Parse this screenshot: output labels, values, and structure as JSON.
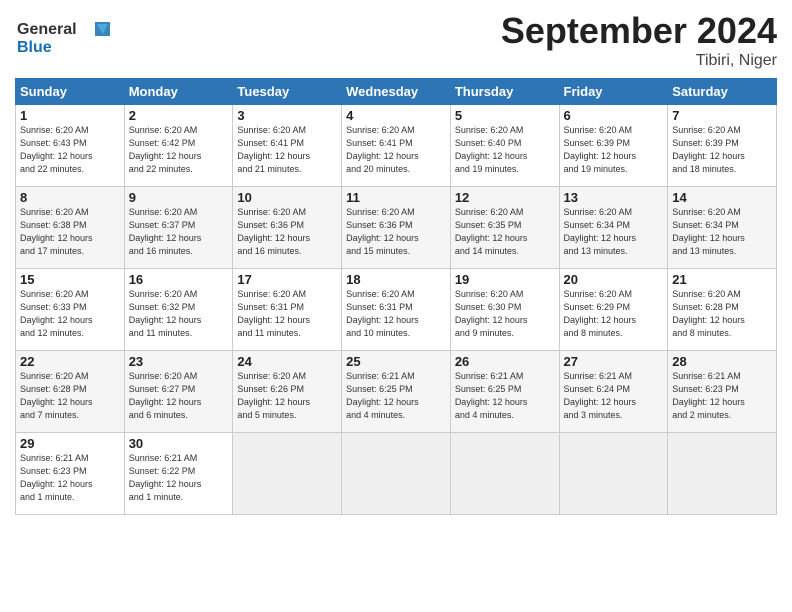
{
  "header": {
    "logo_line1": "General",
    "logo_line2": "Blue",
    "month": "September 2024",
    "location": "Tibiri, Niger"
  },
  "days_of_week": [
    "Sunday",
    "Monday",
    "Tuesday",
    "Wednesday",
    "Thursday",
    "Friday",
    "Saturday"
  ],
  "weeks": [
    [
      {
        "day": "1",
        "info": "Sunrise: 6:20 AM\nSunset: 6:43 PM\nDaylight: 12 hours\nand 22 minutes."
      },
      {
        "day": "2",
        "info": "Sunrise: 6:20 AM\nSunset: 6:42 PM\nDaylight: 12 hours\nand 22 minutes."
      },
      {
        "day": "3",
        "info": "Sunrise: 6:20 AM\nSunset: 6:41 PM\nDaylight: 12 hours\nand 21 minutes."
      },
      {
        "day": "4",
        "info": "Sunrise: 6:20 AM\nSunset: 6:41 PM\nDaylight: 12 hours\nand 20 minutes."
      },
      {
        "day": "5",
        "info": "Sunrise: 6:20 AM\nSunset: 6:40 PM\nDaylight: 12 hours\nand 19 minutes."
      },
      {
        "day": "6",
        "info": "Sunrise: 6:20 AM\nSunset: 6:39 PM\nDaylight: 12 hours\nand 19 minutes."
      },
      {
        "day": "7",
        "info": "Sunrise: 6:20 AM\nSunset: 6:39 PM\nDaylight: 12 hours\nand 18 minutes."
      }
    ],
    [
      {
        "day": "8",
        "info": "Sunrise: 6:20 AM\nSunset: 6:38 PM\nDaylight: 12 hours\nand 17 minutes."
      },
      {
        "day": "9",
        "info": "Sunrise: 6:20 AM\nSunset: 6:37 PM\nDaylight: 12 hours\nand 16 minutes."
      },
      {
        "day": "10",
        "info": "Sunrise: 6:20 AM\nSunset: 6:36 PM\nDaylight: 12 hours\nand 16 minutes."
      },
      {
        "day": "11",
        "info": "Sunrise: 6:20 AM\nSunset: 6:36 PM\nDaylight: 12 hours\nand 15 minutes."
      },
      {
        "day": "12",
        "info": "Sunrise: 6:20 AM\nSunset: 6:35 PM\nDaylight: 12 hours\nand 14 minutes."
      },
      {
        "day": "13",
        "info": "Sunrise: 6:20 AM\nSunset: 6:34 PM\nDaylight: 12 hours\nand 13 minutes."
      },
      {
        "day": "14",
        "info": "Sunrise: 6:20 AM\nSunset: 6:34 PM\nDaylight: 12 hours\nand 13 minutes."
      }
    ],
    [
      {
        "day": "15",
        "info": "Sunrise: 6:20 AM\nSunset: 6:33 PM\nDaylight: 12 hours\nand 12 minutes."
      },
      {
        "day": "16",
        "info": "Sunrise: 6:20 AM\nSunset: 6:32 PM\nDaylight: 12 hours\nand 11 minutes."
      },
      {
        "day": "17",
        "info": "Sunrise: 6:20 AM\nSunset: 6:31 PM\nDaylight: 12 hours\nand 11 minutes."
      },
      {
        "day": "18",
        "info": "Sunrise: 6:20 AM\nSunset: 6:31 PM\nDaylight: 12 hours\nand 10 minutes."
      },
      {
        "day": "19",
        "info": "Sunrise: 6:20 AM\nSunset: 6:30 PM\nDaylight: 12 hours\nand 9 minutes."
      },
      {
        "day": "20",
        "info": "Sunrise: 6:20 AM\nSunset: 6:29 PM\nDaylight: 12 hours\nand 8 minutes."
      },
      {
        "day": "21",
        "info": "Sunrise: 6:20 AM\nSunset: 6:28 PM\nDaylight: 12 hours\nand 8 minutes."
      }
    ],
    [
      {
        "day": "22",
        "info": "Sunrise: 6:20 AM\nSunset: 6:28 PM\nDaylight: 12 hours\nand 7 minutes."
      },
      {
        "day": "23",
        "info": "Sunrise: 6:20 AM\nSunset: 6:27 PM\nDaylight: 12 hours\nand 6 minutes."
      },
      {
        "day": "24",
        "info": "Sunrise: 6:20 AM\nSunset: 6:26 PM\nDaylight: 12 hours\nand 5 minutes."
      },
      {
        "day": "25",
        "info": "Sunrise: 6:21 AM\nSunset: 6:25 PM\nDaylight: 12 hours\nand 4 minutes."
      },
      {
        "day": "26",
        "info": "Sunrise: 6:21 AM\nSunset: 6:25 PM\nDaylight: 12 hours\nand 4 minutes."
      },
      {
        "day": "27",
        "info": "Sunrise: 6:21 AM\nSunset: 6:24 PM\nDaylight: 12 hours\nand 3 minutes."
      },
      {
        "day": "28",
        "info": "Sunrise: 6:21 AM\nSunset: 6:23 PM\nDaylight: 12 hours\nand 2 minutes."
      }
    ],
    [
      {
        "day": "29",
        "info": "Sunrise: 6:21 AM\nSunset: 6:23 PM\nDaylight: 12 hours\nand 1 minute."
      },
      {
        "day": "30",
        "info": "Sunrise: 6:21 AM\nSunset: 6:22 PM\nDaylight: 12 hours\nand 1 minute."
      },
      {
        "day": "",
        "info": ""
      },
      {
        "day": "",
        "info": ""
      },
      {
        "day": "",
        "info": ""
      },
      {
        "day": "",
        "info": ""
      },
      {
        "day": "",
        "info": ""
      }
    ]
  ]
}
